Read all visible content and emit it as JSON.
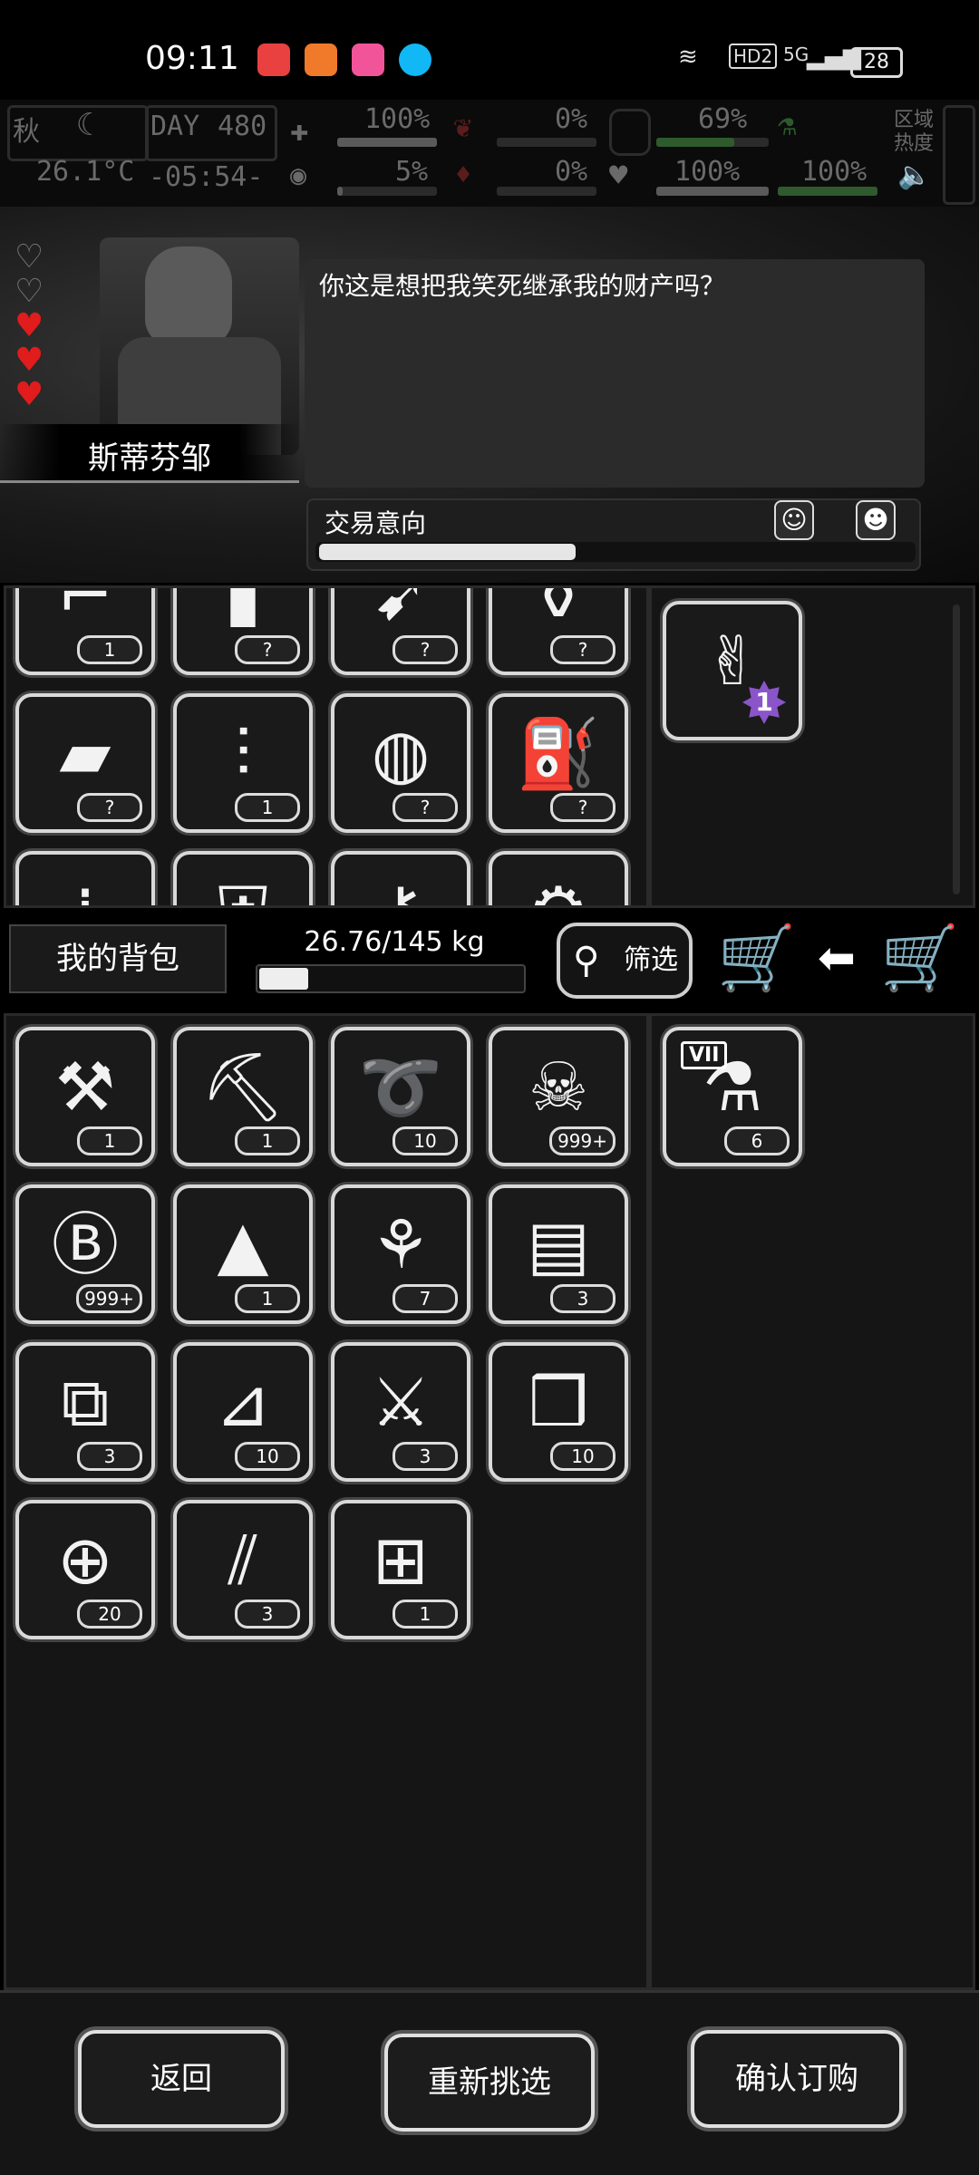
{
  "status_bar": {
    "time": "09:11",
    "network": "HD2",
    "signal": "5G",
    "battery": "28",
    "app_icons": [
      "pinduoduo-icon",
      "reader-icon",
      "bilibili-icon",
      "qq-icon"
    ]
  },
  "hud": {
    "season": "秋",
    "day_label": "DAY",
    "day": "480",
    "temperature": "26.1°C",
    "clock": "-05:54-",
    "stats": [
      "100%",
      "5%",
      "0%",
      "0%",
      "69%",
      "100%",
      "100%"
    ],
    "zone_heat": "区域\n热度"
  },
  "npc": {
    "name": "斯蒂芬邹",
    "hearts_empty": 2,
    "hearts_full": 3,
    "speech": "你这是想把我笑死继承我的财产吗？"
  },
  "trade": {
    "label": "交易意向",
    "intent_level": 0.43
  },
  "merchant_items": [
    {
      "icon": "rifle-icon",
      "qty": "1"
    },
    {
      "icon": "shell-icon",
      "qty": "?"
    },
    {
      "icon": "rocket-launcher-icon",
      "qty": "?"
    },
    {
      "icon": "vase-icon",
      "qty": "?"
    },
    {
      "icon": "gold-bars-icon",
      "qty": "?"
    },
    {
      "icon": "minigun-icon",
      "qty": "1"
    },
    {
      "icon": "grenade-icon",
      "qty": "?"
    },
    {
      "icon": "fire-extinguisher-icon",
      "qty": "?"
    },
    {
      "icon": "bullets-icon",
      "qty": ""
    },
    {
      "icon": "armor-vest-icon",
      "qty": ""
    },
    {
      "icon": "key-icon",
      "qty": ""
    },
    {
      "icon": "gear-part-icon",
      "qty": ""
    }
  ],
  "merchant_selected": [
    {
      "icon": "bandage-rolls-icon",
      "badge": "1"
    }
  ],
  "bag": {
    "label": "我的背包",
    "weight": "26.76/145 kg",
    "weight_ratio": 0.1846,
    "filter_label": "筛选"
  },
  "bag_items": [
    {
      "icon": "crowbar-icon",
      "qty": "1"
    },
    {
      "icon": "shovel-icon",
      "qty": "1"
    },
    {
      "icon": "rope-icon",
      "qty": "10"
    },
    {
      "icon": "zombie-poster-icon",
      "qty": "999+"
    },
    {
      "icon": "bitcoin-chip-icon",
      "qty": "999+"
    },
    {
      "icon": "bloody-cloth-icon",
      "qty": "1"
    },
    {
      "icon": "tool-bag-icon",
      "qty": "7"
    },
    {
      "icon": "tool-case-icon",
      "qty": "3"
    },
    {
      "icon": "toolbox-icon",
      "qty": "3"
    },
    {
      "icon": "paper-roll-icon",
      "qty": "10"
    },
    {
      "icon": "pliers-case-icon",
      "qty": "3"
    },
    {
      "icon": "ice-cubes-icon",
      "qty": "10"
    },
    {
      "icon": "net-icon",
      "qty": "20"
    },
    {
      "icon": "tweezers-icon",
      "qty": "3"
    },
    {
      "icon": "large-toolbox-icon",
      "qty": "1"
    }
  ],
  "bag_selected": [
    {
      "icon": "test-tube-icon",
      "tag": "VII",
      "qty": "6"
    }
  ],
  "buttons": {
    "back": "返回",
    "reselect": "重新挑选",
    "confirm": "确认订购"
  }
}
